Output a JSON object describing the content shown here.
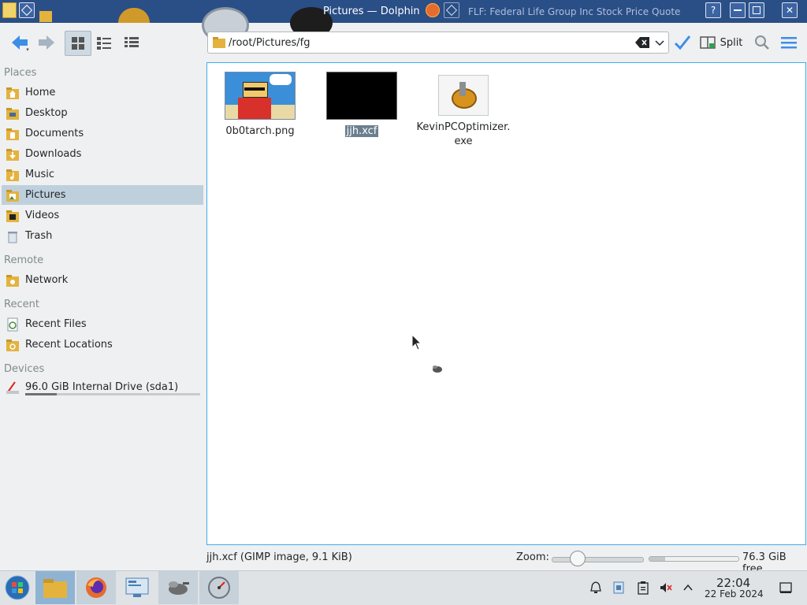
{
  "window": {
    "title": "Pictures — Dolphin",
    "other_title": "FLF: Federal Life Group Inc Stock Price Quote",
    "help_label": "?"
  },
  "toolbar": {
    "location_path": "/root/Pictures/fg",
    "split_label": "Split"
  },
  "sidebar": {
    "places_header": "Places",
    "places": [
      {
        "label": "Home",
        "icon": "home-folder-icon"
      },
      {
        "label": "Desktop",
        "icon": "desktop-folder-icon"
      },
      {
        "label": "Documents",
        "icon": "documents-folder-icon"
      },
      {
        "label": "Downloads",
        "icon": "downloads-folder-icon"
      },
      {
        "label": "Music",
        "icon": "music-folder-icon"
      },
      {
        "label": "Pictures",
        "icon": "pictures-folder-icon",
        "selected": true
      },
      {
        "label": "Videos",
        "icon": "videos-folder-icon"
      },
      {
        "label": "Trash",
        "icon": "trash-icon"
      }
    ],
    "remote_header": "Remote",
    "remote": [
      {
        "label": "Network",
        "icon": "network-folder-icon"
      }
    ],
    "recent_header": "Recent",
    "recent": [
      {
        "label": "Recent Files",
        "icon": "recent-files-icon"
      },
      {
        "label": "Recent Locations",
        "icon": "recent-locations-icon"
      }
    ],
    "devices_header": "Devices",
    "devices": [
      {
        "label": "96.0 GiB Internal Drive (sda1)",
        "icon": "hard-drive-icon",
        "usage_fraction": 0.18
      }
    ]
  },
  "files": [
    {
      "name": "0b0tarch.png",
      "type": "image-thumbnail"
    },
    {
      "name": "jjh.xcf",
      "type": "black-thumbnail",
      "selected": true
    },
    {
      "name_line1": "KevinPCOptimizer.",
      "name_line2": "exe",
      "type": "executable"
    }
  ],
  "status": {
    "selection_info": "jjh.xcf (GIMP image, 9.1 KiB)",
    "zoom_label": "Zoom:",
    "zoom_fraction": 0.2,
    "free_space": "76.3 GiB free",
    "free_used_fraction": 0.18
  },
  "taskbar": {
    "time": "22:04",
    "date": "22 Feb 2024"
  },
  "colors": {
    "accent": "#3daee9",
    "titlebar": "#2a4e86",
    "selection": "#bfd0dd"
  }
}
